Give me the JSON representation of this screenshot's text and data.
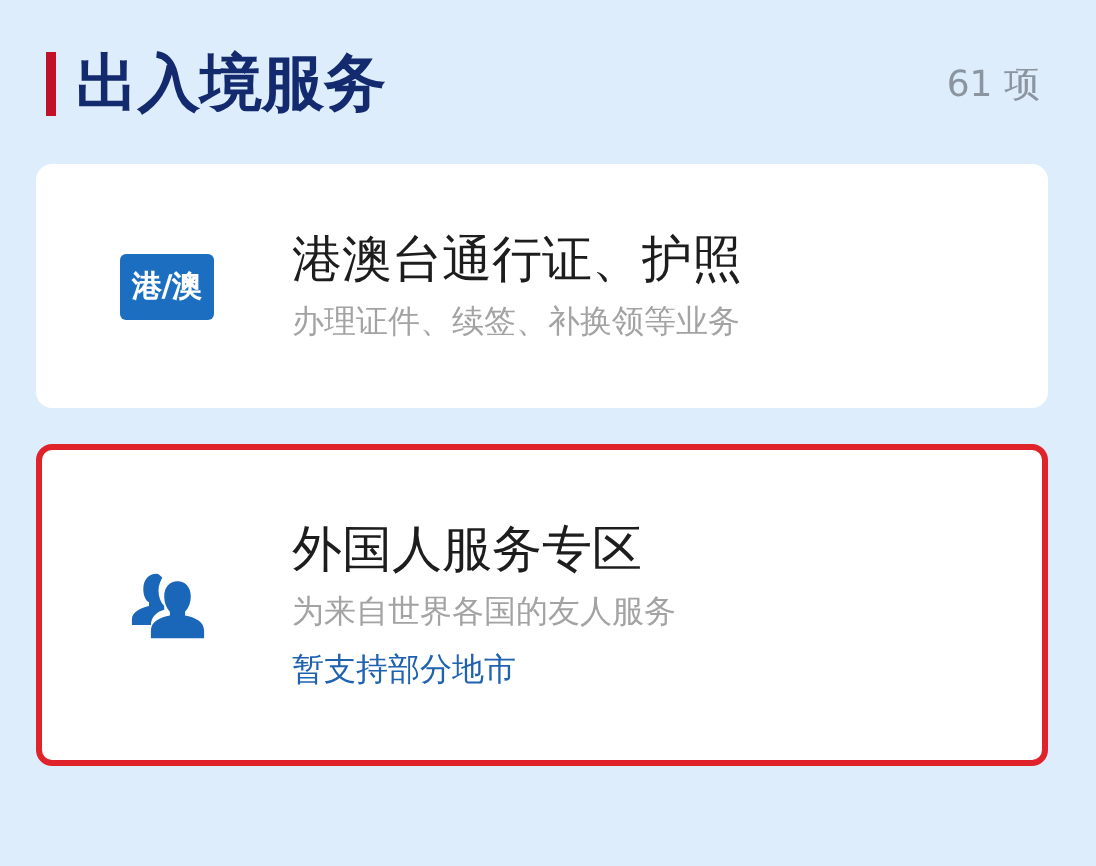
{
  "section": {
    "title": "出入境服务",
    "count": "61 项"
  },
  "services": [
    {
      "kind": "badge",
      "badge": "港/澳",
      "title": "港澳台通行证、护照",
      "subtitle": "办理证件、续签、补换领等业务",
      "highlighted": false
    },
    {
      "kind": "people",
      "title": "外国人服务专区",
      "subtitle": "为来自世界各国的友人服务",
      "note": "暂支持部分地市",
      "highlighted": true
    }
  ]
}
